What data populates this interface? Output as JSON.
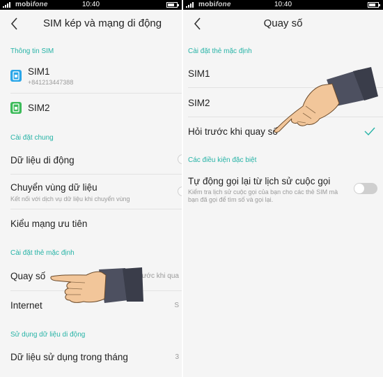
{
  "statusbar": {
    "carrier_part1": "mobi",
    "carrier_part2": "fone",
    "time": "10:40"
  },
  "left_screen": {
    "title": "SIM kép và mạng di động",
    "sections": {
      "sim_info": "Thông tin SIM",
      "general": "Cài đặt chung",
      "default_card": "Cài đặt thẻ mặc định",
      "mobile_data_usage": "Sử dụng dữ liệu di động"
    },
    "sim1": {
      "label": "SIM1",
      "number": "+841213447388"
    },
    "sim2": {
      "label": "SIM2"
    },
    "mobile_data": "Dữ liệu di động",
    "data_roaming": {
      "label": "Chuyển vùng dữ liệu",
      "sub": "Kết nối với dịch vụ dữ liệu khi chuyển vùng"
    },
    "preferred_network": "Kiểu mạng ưu tiên",
    "dial": {
      "label": "Quay số",
      "value": "ước khi qua"
    },
    "internet": {
      "label": "Internet",
      "value": "S"
    },
    "monthly_usage": "Dữ liệu sử dụng trong tháng",
    "colors": {
      "accent": "#26b3a6",
      "sim1_icon": "#2aa6e8",
      "sim2_icon": "#3dbb5a"
    }
  },
  "right_screen": {
    "title": "Quay số",
    "sections": {
      "default_card": "Cài đặt thẻ mặc định",
      "special": "Các điều kiện đặc biệt"
    },
    "options": [
      "SIM1",
      "SIM2",
      "Hỏi trước khi quay số"
    ],
    "selected_option": "Hỏi trước khi quay số",
    "auto_redial": {
      "label": "Tự động gọi lại từ lịch sử cuộc gọi",
      "sub_line1": "Kiểm tra lịch sử cuộc gọi của bạn cho các thẻ SIM mà",
      "sub_line2": "bạn đã gọi để tìm số và gọi lại.",
      "enabled": false
    }
  }
}
